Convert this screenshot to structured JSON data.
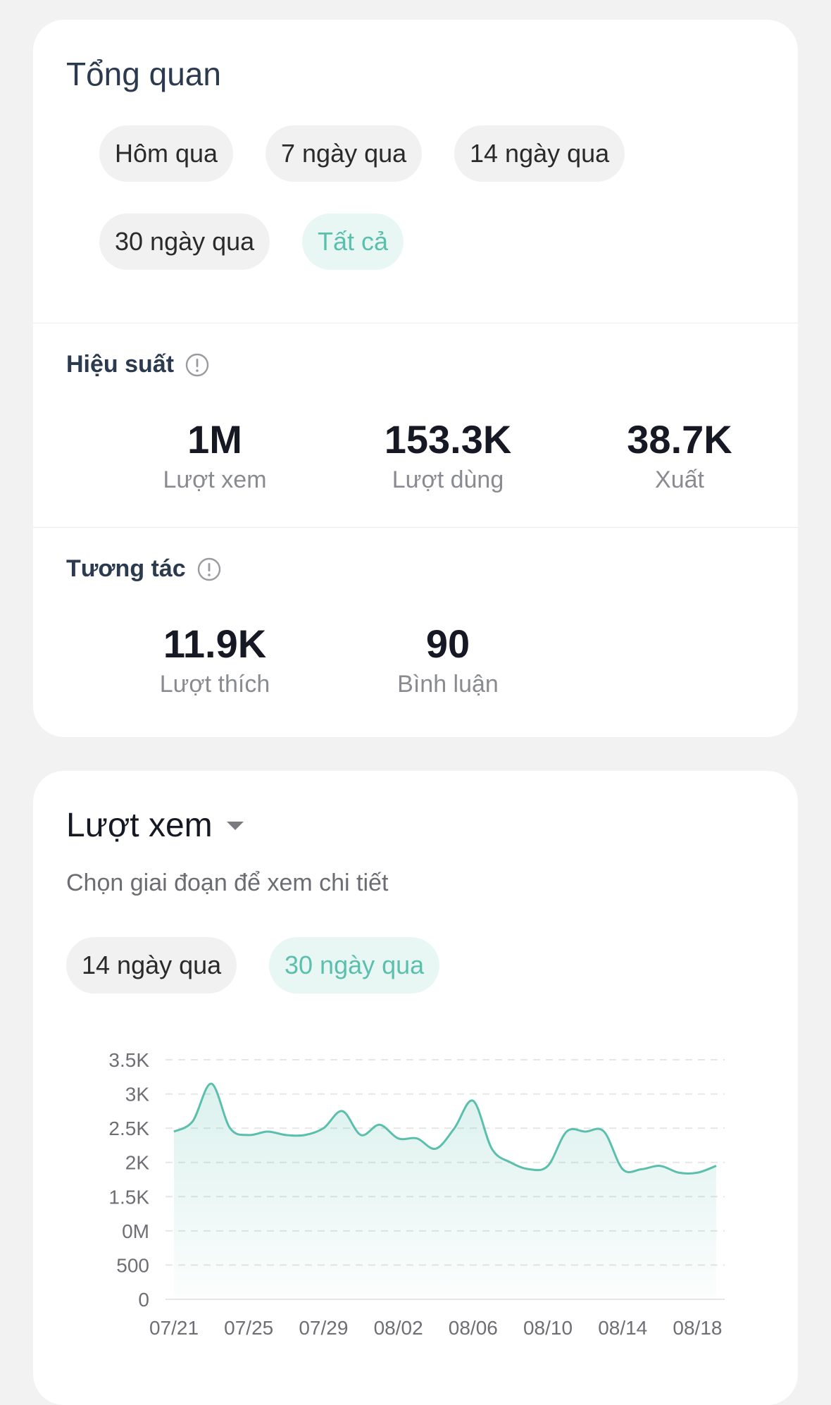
{
  "overview": {
    "title": "Tổng quan",
    "filters": [
      "Hôm qua",
      "7 ngày qua",
      "14 ngày qua",
      "30 ngày qua",
      "Tất cả"
    ],
    "active_filter": "Tất cả"
  },
  "performance": {
    "title": "Hiệu suất",
    "metrics": [
      {
        "value": "1M",
        "label": "Lượt xem"
      },
      {
        "value": "153.3K",
        "label": "Lượt dùng"
      },
      {
        "value": "38.7K",
        "label": "Xuất"
      }
    ]
  },
  "engagement": {
    "title": "Tương tác",
    "metrics": [
      {
        "value": "11.9K",
        "label": "Lượt thích"
      },
      {
        "value": "90",
        "label": "Bình luận"
      }
    ]
  },
  "chart_section": {
    "title": "Lượt xem",
    "subtitle": "Chọn giai đoạn để xem chi tiết",
    "ranges": [
      "14 ngày qua",
      "30 ngày qua"
    ],
    "active_range": "30 ngày qua"
  },
  "colors": {
    "accent": "#5bbfad",
    "accent_bg": "#e9f7f4",
    "line": "#5bbfad"
  },
  "chart_data": {
    "type": "area",
    "title": "",
    "xlabel": "",
    "ylabel": "",
    "y_tick_labels": [
      "0",
      "500",
      "0M",
      "1.5K",
      "2K",
      "2.5K",
      "3K",
      "3.5K"
    ],
    "y_tick_values": [
      0,
      500,
      1000,
      1500,
      2000,
      2500,
      3000,
      3500
    ],
    "ylim": [
      0,
      3500
    ],
    "x_tick_labels": [
      "07/21",
      "07/25",
      "07/29",
      "08/02",
      "08/06",
      "08/10",
      "08/14",
      "08/18"
    ],
    "grid": true,
    "series": [
      {
        "x": [
          "07/21",
          "07/22",
          "07/23",
          "07/24",
          "07/25",
          "07/26",
          "07/27",
          "07/28",
          "07/29",
          "07/30",
          "07/31",
          "08/01",
          "08/02",
          "08/03",
          "08/04",
          "08/05",
          "08/06",
          "08/07",
          "08/08",
          "08/09",
          "08/10",
          "08/11",
          "08/12",
          "08/13",
          "08/14",
          "08/15",
          "08/16",
          "08/17",
          "08/18",
          "08/19"
        ],
        "values": [
          2450,
          2600,
          3150,
          2500,
          2400,
          2450,
          2400,
          2400,
          2500,
          2750,
          2400,
          2550,
          2350,
          2350,
          2200,
          2500,
          2900,
          2200,
          2000,
          1900,
          1950,
          2450,
          2450,
          2450,
          1900,
          1900,
          1950,
          1850,
          1850,
          1950
        ]
      }
    ]
  }
}
